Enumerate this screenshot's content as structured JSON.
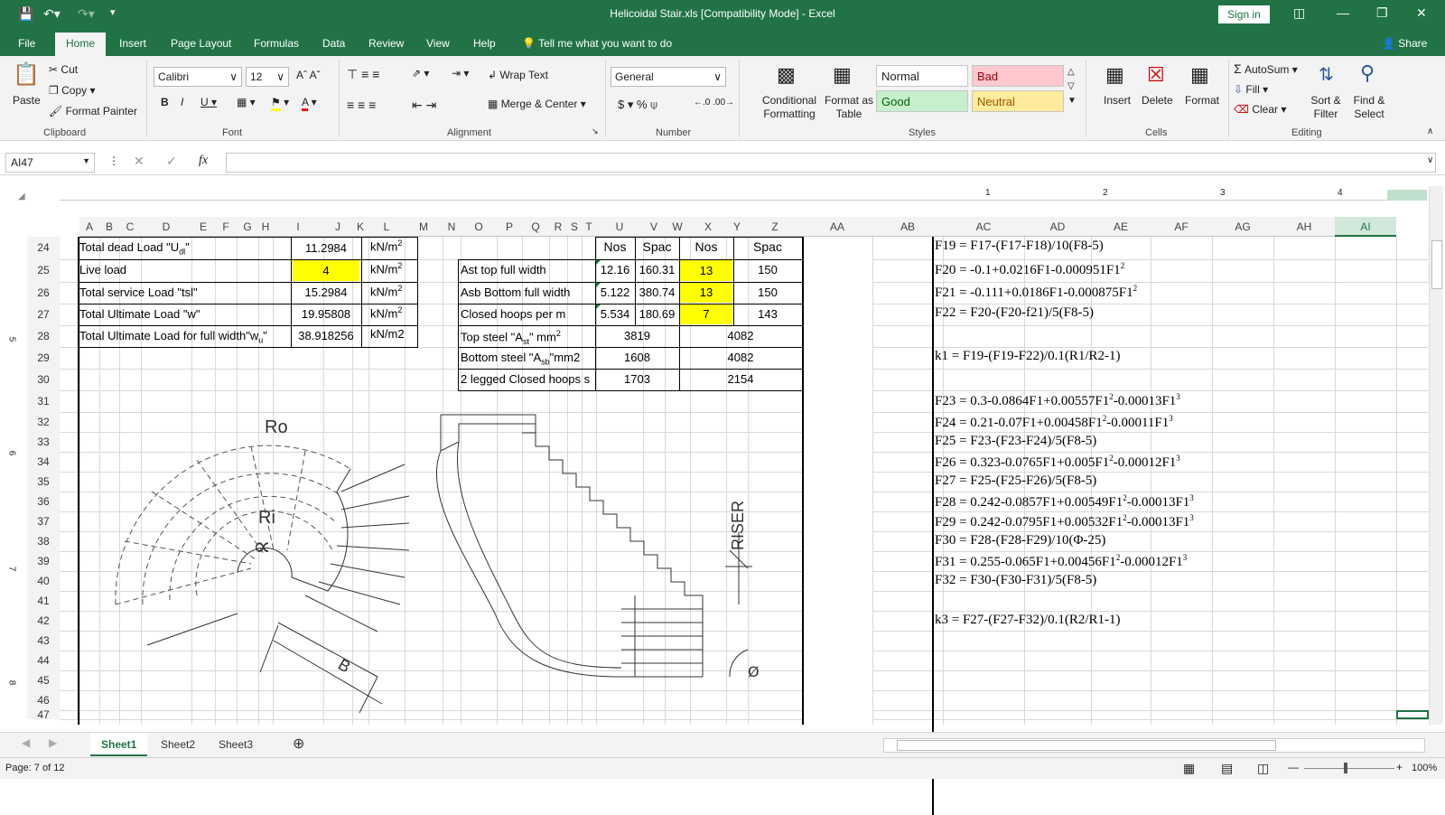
{
  "window": {
    "title": "Helicoidal Stair.xls  [Compatibility Mode]  -  Excel",
    "signin": "Sign in"
  },
  "tabs": [
    "File",
    "Home",
    "Insert",
    "Page Layout",
    "Formulas",
    "Data",
    "Review",
    "View",
    "Help"
  ],
  "tellme": "Tell me what you want to do",
  "share": "Share",
  "ribbon": {
    "clipboard": {
      "paste": "Paste",
      "cut": "Cut",
      "copy": "Copy",
      "format_painter": "Format Painter",
      "label": "Clipboard"
    },
    "font": {
      "name": "Calibri",
      "size": "12",
      "label": "Font"
    },
    "alignment": {
      "wrap": "Wrap Text",
      "merge": "Merge & Center",
      "label": "Alignment"
    },
    "number": {
      "format": "General",
      "label": "Number"
    },
    "styles": {
      "conditional": "Conditional Formatting",
      "format_table": "Format as Table",
      "normal": "Normal",
      "bad": "Bad",
      "good": "Good",
      "neutral": "Neutral",
      "label": "Styles"
    },
    "cells": {
      "insert": "Insert",
      "delete": "Delete",
      "format": "Format",
      "label": "Cells"
    },
    "editing": {
      "autosum": "AutoSum",
      "fill": "Fill",
      "clear": "Clear",
      "sort": "Sort & Filter",
      "find": "Find & Select",
      "label": "Editing"
    }
  },
  "namebox": "AI47",
  "columns": [
    "A",
    "B",
    "C",
    "D",
    "E",
    "F",
    "G",
    "H",
    "I",
    "J",
    "K",
    "L",
    "M",
    "N",
    "O",
    "P",
    "Q",
    "R",
    "S",
    "T",
    "U",
    "V",
    "W",
    "X",
    "Y",
    "Z",
    "AA",
    "AB",
    "AC",
    "AD",
    "AE",
    "AF",
    "AG",
    "AH",
    "AI"
  ],
  "rows": [
    "24",
    "25",
    "26",
    "27",
    "28",
    "29",
    "30",
    "31",
    "32",
    "33",
    "34",
    "35",
    "36",
    "37",
    "38",
    "39",
    "40",
    "41",
    "42",
    "43",
    "44",
    "45",
    "46",
    "47"
  ],
  "ruler": {
    "r1": "1",
    "r2": "2",
    "r3": "3",
    "r4": "4",
    "left5": "5",
    "left6": "6",
    "left7": "7",
    "left8": "8"
  },
  "loads": [
    {
      "label": "Total dead Load \"U",
      "sub": "dl",
      "tail": "\"",
      "value": "11.2984",
      "unit": "kN/m",
      "sup": "2"
    },
    {
      "label": "Live load",
      "sub": "",
      "tail": "",
      "value": "4",
      "unit": "kN/m",
      "sup": "2"
    },
    {
      "label": "Total service Load \"tsl\"",
      "sub": "",
      "tail": "",
      "value": "15.2984",
      "unit": "kN/m",
      "sup": "2"
    },
    {
      "label": "Total Ultimate Load \"w\"",
      "sub": "",
      "tail": "",
      "value": "19.95808",
      "unit": "kN/m",
      "sup": "2"
    },
    {
      "label": "Total Ultimate Load for full width\"w",
      "sub": "u",
      "tail": "\"",
      "value": "38.918256",
      "unit": "kN/m2",
      "sup": ""
    }
  ],
  "steel": {
    "headers": [
      "Nos",
      "Spac",
      "Nos",
      "Spac"
    ],
    "rows": [
      {
        "label": "Ast top full width",
        "a": "12.16",
        "b": "160.31",
        "c": "13",
        "d": "150"
      },
      {
        "label": "Asb Bottom full width",
        "a": "5.122",
        "b": "380.74",
        "c": "13",
        "d": "150"
      },
      {
        "label": "Closed hoops per m",
        "a": "5.534",
        "b": "180.69",
        "c": "7",
        "d": "143"
      }
    ],
    "totals": [
      {
        "label": "Top steel \"A",
        "sub": "st",
        "tail": "\" mm",
        "sup": "2",
        "v1": "3819",
        "v2": "4082"
      },
      {
        "label": "Bottom steel \"A",
        "sub": "sb",
        "tail": "\"mm2",
        "sup": "",
        "v1": "1608",
        "v2": "4082"
      },
      {
        "label": "2 legged Closed hoops s",
        "sub": "",
        "tail": "",
        "sup": "",
        "v1": "1703",
        "v2": "2154"
      }
    ]
  },
  "drawing": {
    "ro": "Ro",
    "ri": "Ri",
    "alpha": "∝",
    "b": "B",
    "riser": "RISER",
    "phi": "Ø"
  },
  "equations": [
    {
      "row": 0,
      "text": "F19 = F17-(F17-F18)/10(F8-5)"
    },
    {
      "row": 1,
      "text": "F20 = -0.1+0.0216F1-0.000951F1",
      "sup": "2"
    },
    {
      "row": 2,
      "text": "F21 = -0.111+0.0186F1-0.000875F1",
      "sup": "2"
    },
    {
      "row": 3,
      "text": "F22 = F20-(F20-f21)/5(F8-5)"
    },
    {
      "row": 5,
      "text": "k1 = F19-(F19-F22)/0.1(R1/R2-1)"
    },
    {
      "row": 7,
      "text": "F23 = 0.3-0.0864F1+0.00557F1",
      "sup": "2",
      "mid": "-0.00013F1",
      "sup2": "3"
    },
    {
      "row": 8,
      "text": "F24 = 0.21-0.07F1+0.00458F1",
      "sup": "2",
      "mid": "-0.00011F1",
      "sup2": "3"
    },
    {
      "row": 9,
      "text": "F25 = F23-(F23-F24)/5(F8-5)"
    },
    {
      "row": 10,
      "text": "F26 = 0.323-0.0765F1+0.005F1",
      "sup": "2",
      "mid": "-0.00012F1",
      "sup2": "3"
    },
    {
      "row": 11,
      "text": "F27 = F25-(F25-F26)/5(F8-5)"
    },
    {
      "row": 12,
      "text": "F28 = 0.242-0.0857F1+0.00549F1",
      "sup": "2",
      "mid": "-0.00013F1",
      "sup2": "3"
    },
    {
      "row": 13,
      "text": "F29 = 0.242-0.0795F1+0.00532F1",
      "sup": "2",
      "mid": "-0.00013F1",
      "sup2": "3"
    },
    {
      "row": 14,
      "text": "F30 = F28-(F28-F29)/10(Φ-25)"
    },
    {
      "row": 15,
      "text": "F31 = 0.255-0.065F1+0.00456F1",
      "sup": "2",
      "mid": "-0.00012F1",
      "sup2": "3"
    },
    {
      "row": 16,
      "text": "F32 = F30-(F30-F31)/5(F8-5)"
    },
    {
      "row": 18,
      "text": "k3 = F27-(F27-F32)/0.1(R2/R1-1)"
    }
  ],
  "sheets": [
    "Sheet1",
    "Sheet2",
    "Sheet3"
  ],
  "status": {
    "page": "Page: 7 of 12",
    "zoom": "100%"
  },
  "colors": {
    "excel_green": "#217346",
    "yellow": "#ffff00",
    "bad_bg": "#ffc7ce",
    "good_bg": "#c6efce",
    "neutral_bg": "#ffeb9c"
  }
}
